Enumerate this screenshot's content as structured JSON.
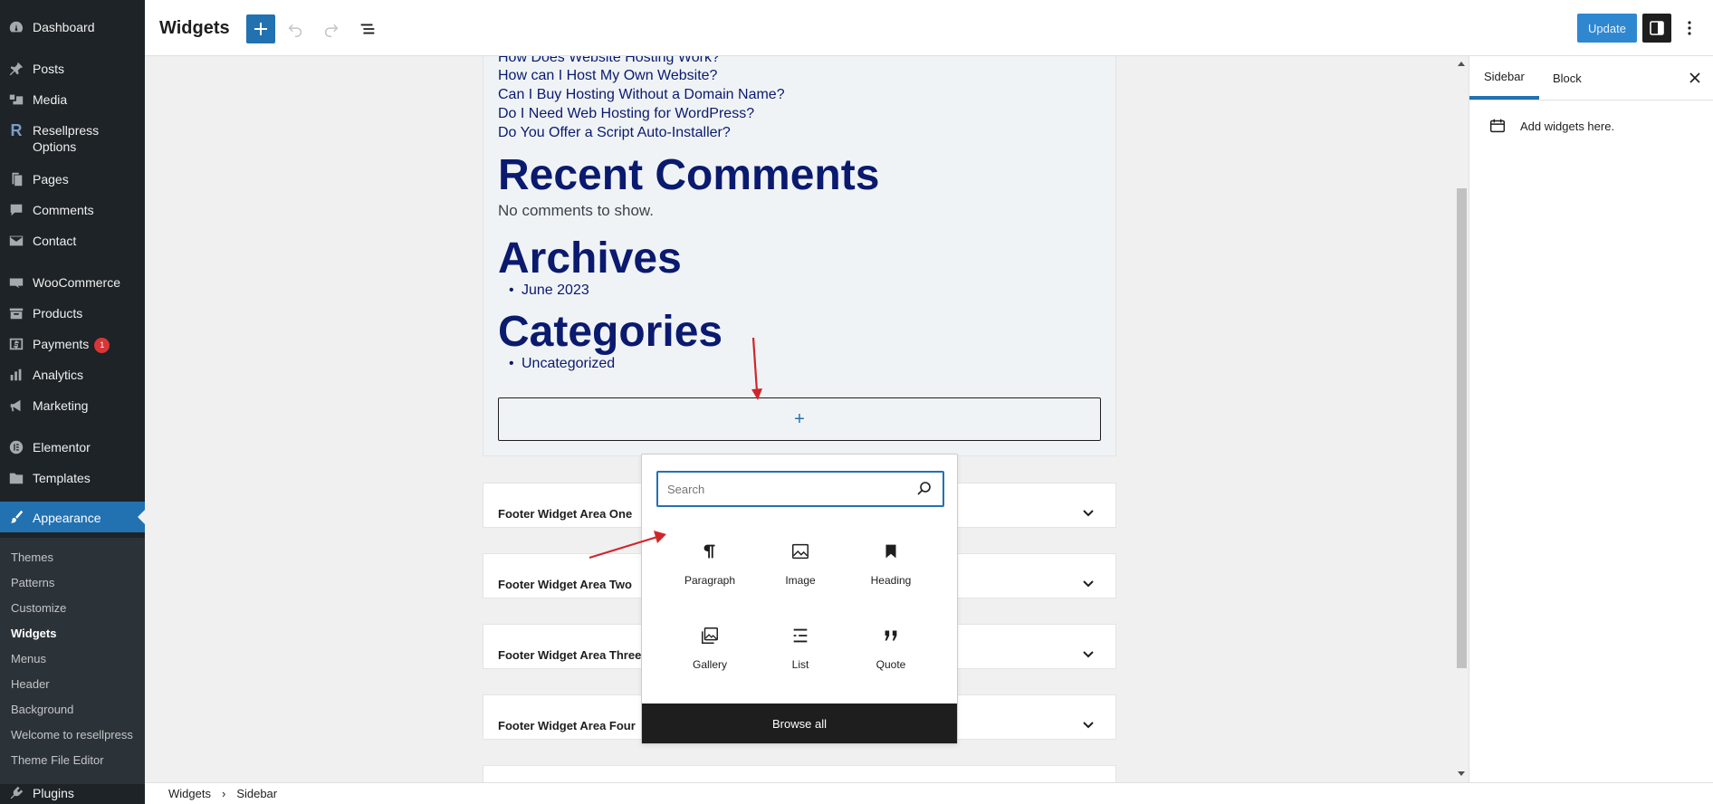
{
  "admin_menu": {
    "items": [
      {
        "label": "Dashboard"
      },
      {
        "label": "Posts"
      },
      {
        "label": "Media"
      },
      {
        "label": "Resellpress Options"
      },
      {
        "label": "Pages"
      },
      {
        "label": "Comments"
      },
      {
        "label": "Contact"
      },
      {
        "label": "WooCommerce"
      },
      {
        "label": "Products"
      },
      {
        "label": "Payments",
        "badge": "1"
      },
      {
        "label": "Analytics"
      },
      {
        "label": "Marketing"
      },
      {
        "label": "Elementor"
      },
      {
        "label": "Templates"
      },
      {
        "label": "Appearance"
      },
      {
        "label": "Plugins"
      }
    ],
    "submenu": [
      {
        "label": "Themes"
      },
      {
        "label": "Patterns"
      },
      {
        "label": "Customize"
      },
      {
        "label": "Widgets"
      },
      {
        "label": "Menus"
      },
      {
        "label": "Header"
      },
      {
        "label": "Background"
      },
      {
        "label": "Welcome to resellpress"
      },
      {
        "label": "Theme File Editor"
      }
    ]
  },
  "header": {
    "title": "Widgets",
    "update_label": "Update"
  },
  "widget_area": {
    "faq_links": [
      "How Does Website Hosting Work?",
      "How can I Host My Own Website?",
      "Can I Buy Hosting Without a Domain Name?",
      "Do I Need Web Hosting for WordPress?",
      "Do You Offer a Script Auto-Installer?"
    ],
    "recent_comments_heading": "Recent Comments",
    "no_comments": "No comments to show.",
    "archives_heading": "Archives",
    "archives_items": [
      "June 2023"
    ],
    "categories_heading": "Categories",
    "categories_items": [
      "Uncategorized"
    ],
    "appender_symbol": "+"
  },
  "footer_areas": [
    "Footer Widget Area One",
    "Footer Widget Area Two",
    "Footer Widget Area Three",
    "Footer Widget Area Four"
  ],
  "inserter": {
    "search_placeholder": "Search",
    "blocks": [
      {
        "label": "Paragraph",
        "icon": "paragraph-icon"
      },
      {
        "label": "Image",
        "icon": "image-icon"
      },
      {
        "label": "Heading",
        "icon": "heading-icon"
      },
      {
        "label": "Gallery",
        "icon": "gallery-icon"
      },
      {
        "label": "List",
        "icon": "list-icon"
      },
      {
        "label": "Quote",
        "icon": "quote-icon"
      }
    ],
    "browse_all": "Browse all"
  },
  "settings_panel": {
    "tabs": [
      "Sidebar",
      "Block"
    ],
    "active_tab": "Sidebar",
    "message": "Add widgets here."
  },
  "breadcrumb": [
    "Widgets",
    "Sidebar"
  ],
  "colors": {
    "admin_bg": "#1d2327",
    "accent": "#2271b1",
    "annotation": "#d0262b"
  }
}
